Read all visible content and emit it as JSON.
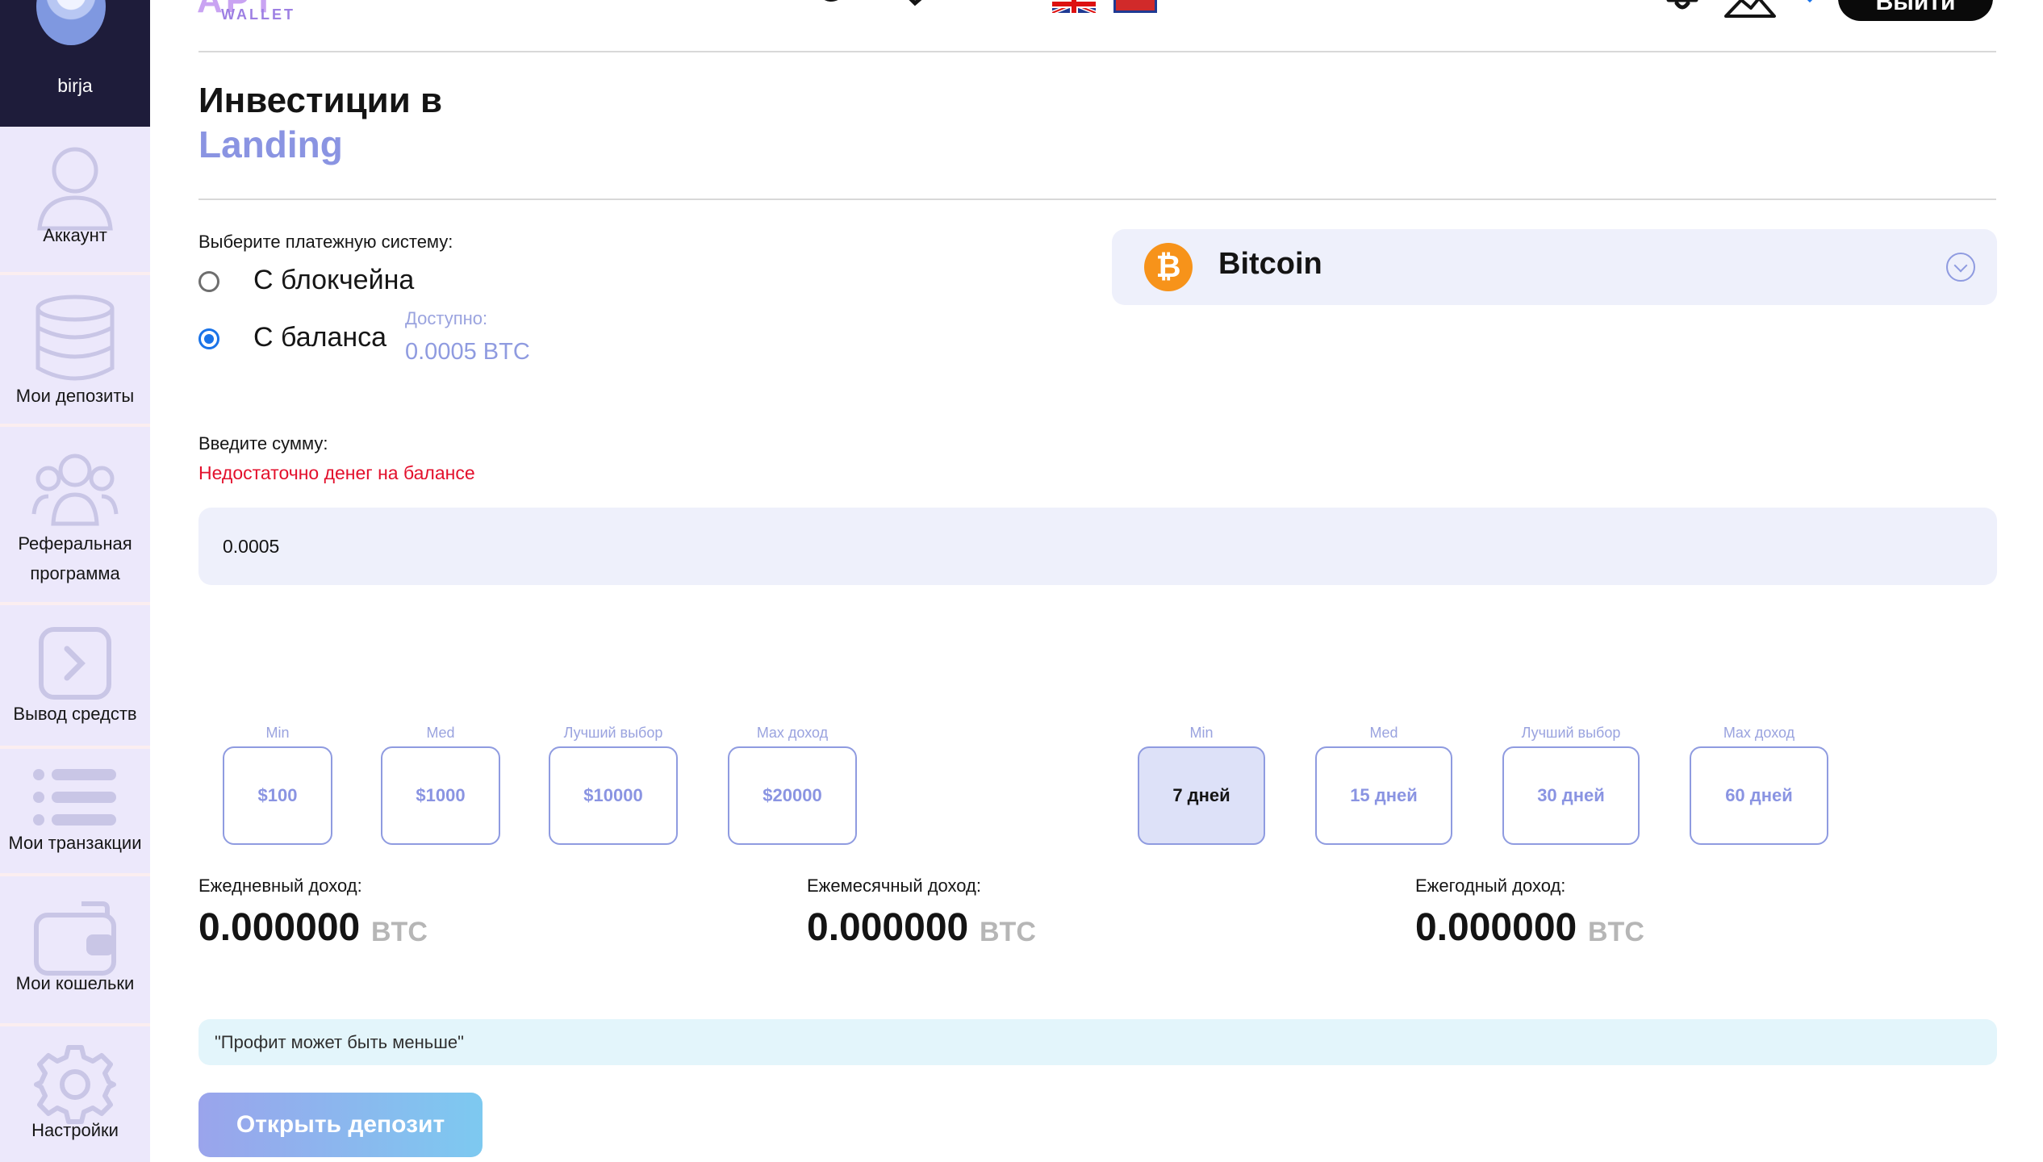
{
  "sidebar": {
    "username": "birja",
    "items": [
      {
        "label": "Аккаунт",
        "icon": "user-icon"
      },
      {
        "label": "Мои депозиты",
        "icon": "coins-stack-icon"
      },
      {
        "label": "Реферальная программа",
        "label_line1": "Реферальная",
        "label_line2": "программа",
        "icon": "users-icon"
      },
      {
        "label": "Вывод средств",
        "icon": "withdraw-icon"
      },
      {
        "label": "Мои транзакции",
        "icon": "list-icon"
      },
      {
        "label": "Мои кошельки",
        "icon": "wallet-icon"
      },
      {
        "label": "Настройки",
        "icon": "gear-icon"
      }
    ]
  },
  "header": {
    "logo_mark": "APT",
    "logo_text": "WALLET",
    "logout_label": "Выйти",
    "icons": [
      "telegram-icon",
      "send-icon",
      "social-icon",
      "flag-uk-icon",
      "flag-ru-icon",
      "bell-icon",
      "mountain-icon"
    ]
  },
  "page": {
    "title_line1": "Инвестиции в",
    "title_line2": "Landing"
  },
  "payment": {
    "label": "Выберите платежную систему:",
    "options": [
      {
        "label": "С блокчейна",
        "selected": false
      },
      {
        "label": "С баланса",
        "selected": true
      }
    ],
    "available_label": "Доступно:",
    "available_value": "0.0005 BTC",
    "coin": {
      "name": "Bitcoin",
      "symbol": "₿",
      "color": "#f7931a"
    }
  },
  "amount": {
    "label": "Введите сумму:",
    "error": "Недостаточно денег на балансе",
    "value": "0.0005"
  },
  "amount_presets": [
    {
      "caption": "Min",
      "label": "$100",
      "selected": false
    },
    {
      "caption": "Med",
      "label": "$1000",
      "selected": false
    },
    {
      "caption": "Лучший выбор",
      "label": "$10000",
      "selected": false
    },
    {
      "caption": "Max доход",
      "label": "$20000",
      "selected": false
    }
  ],
  "period_presets": [
    {
      "caption": "Min",
      "label": "7 дней",
      "selected": true
    },
    {
      "caption": "Med",
      "label": "15 дней",
      "selected": false
    },
    {
      "caption": "Лучший выбор",
      "label": "30 дней",
      "selected": false
    },
    {
      "caption": "Max доход",
      "label": "60 дней",
      "selected": false
    }
  ],
  "income": [
    {
      "label": "Ежедневный доход:",
      "value": "0.000000",
      "currency": "BTC"
    },
    {
      "label": "Ежемесячный доход:",
      "value": "0.000000",
      "currency": "BTC"
    },
    {
      "label": "Ежегодный доход:",
      "value": "0.000000",
      "currency": "BTC"
    }
  ],
  "notice": "\"Профит может быть меньше\"",
  "open_button": "Открыть депозит",
  "colors": {
    "accent": "#8a94e2",
    "error": "#e3102c",
    "sidebar_bg": "#ece8fb",
    "sidebar_user_bg": "#1e1c3a"
  }
}
